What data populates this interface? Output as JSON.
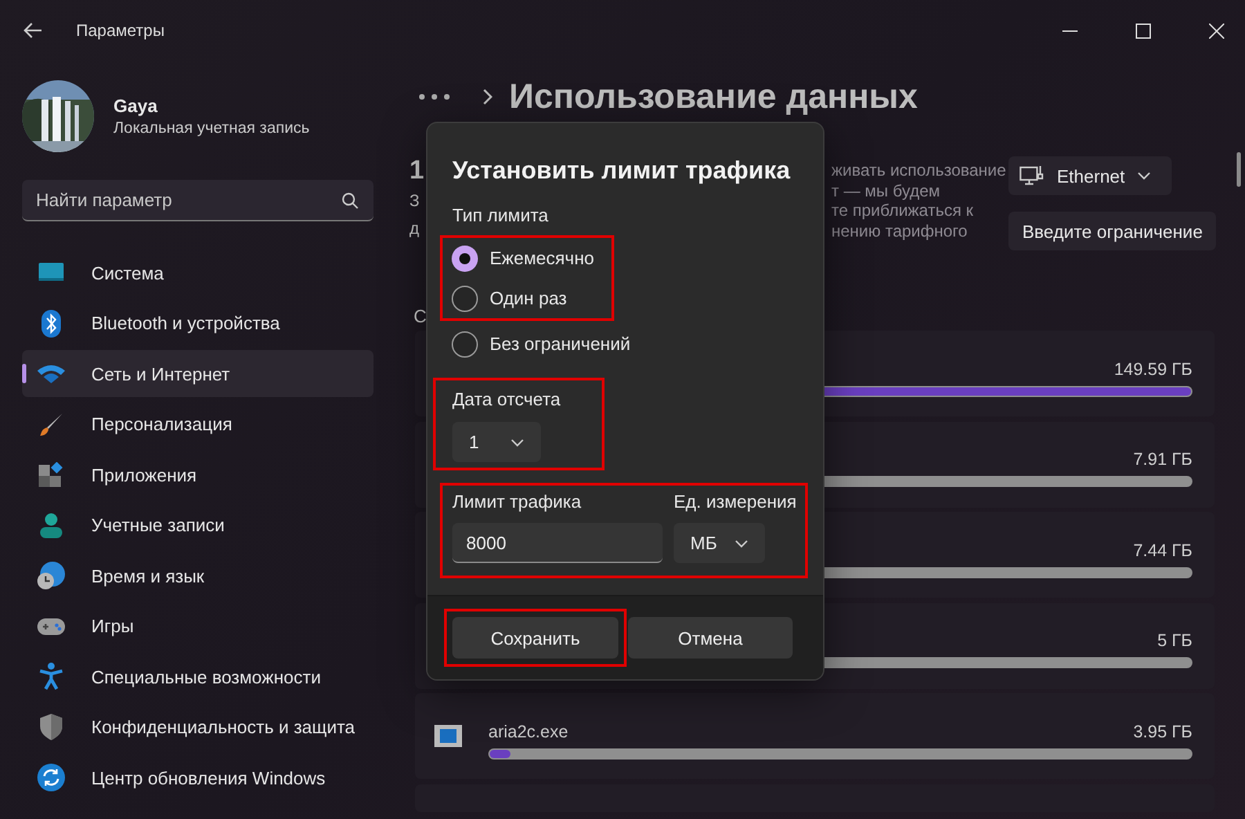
{
  "window": {
    "title": "Параметры"
  },
  "profile": {
    "name": "Gaya",
    "subtitle": "Локальная учетная запись"
  },
  "search": {
    "placeholder": "Найти параметр"
  },
  "nav": [
    {
      "label": "Система",
      "selected": false
    },
    {
      "label": "Bluetooth и устройства",
      "selected": false
    },
    {
      "label": "Сеть и Интернет",
      "selected": true
    },
    {
      "label": "Персонализация",
      "selected": false
    },
    {
      "label": "Приложения",
      "selected": false
    },
    {
      "label": "Учетные записи",
      "selected": false
    },
    {
      "label": "Время и язык",
      "selected": false
    },
    {
      "label": "Игры",
      "selected": false
    },
    {
      "label": "Специальные возможности",
      "selected": false
    },
    {
      "label": "Конфиденциальность и защита",
      "selected": false
    },
    {
      "label": "Центр обновления Windows",
      "selected": false
    }
  ],
  "page": {
    "title": "Использование данных"
  },
  "summary": {
    "left_fragments": [
      "1",
      "З",
      "д"
    ],
    "right_fragments": [
      "живать использование",
      "т — мы будем",
      "те приближаться к",
      "нению тарифного"
    ],
    "network": "Ethernet",
    "limit_button": "Введите ограничение"
  },
  "section_fragment": "С",
  "usage": [
    {
      "usage": "149.59 ГБ",
      "level": 1
    },
    {
      "usage": "7.91 ГБ"
    },
    {
      "usage": "7.44 ГБ"
    },
    {
      "usage": "5 ГБ"
    },
    {
      "name": "aria2c.exe",
      "usage": "3.95 ГБ",
      "level": 0.03
    }
  ],
  "dialog": {
    "title": "Установить лимит трафика",
    "limit_type": {
      "label": "Тип лимита",
      "options": [
        {
          "label": "Ежемесячно",
          "selected": true,
          "highlighted": true
        },
        {
          "label": "Один раз",
          "selected": false,
          "highlighted": true
        },
        {
          "label": "Без ограничений",
          "selected": false,
          "highlighted": false
        }
      ]
    },
    "reset_date": {
      "label": "Дата отсчета",
      "value": "1",
      "highlighted": true
    },
    "limit": {
      "label": "Лимит трафика",
      "value": "8000",
      "unit_label": "Ед. измерения",
      "unit": "МБ",
      "highlighted": true
    },
    "buttons": [
      {
        "label": "Сохранить",
        "highlighted": true
      },
      {
        "label": "Отмена",
        "highlighted": false
      }
    ]
  }
}
